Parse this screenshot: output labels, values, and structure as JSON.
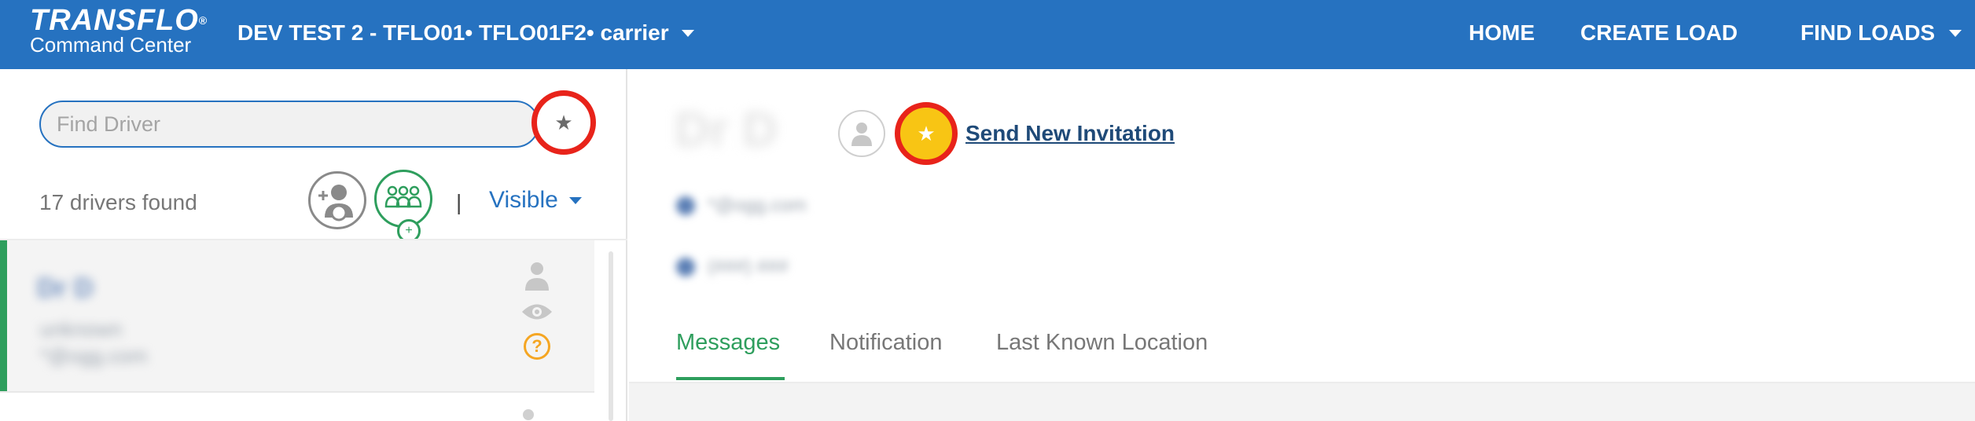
{
  "app": {
    "brand_name": "TRANSFLO",
    "brand_mark": "®",
    "brand_subtitle": "Command Center"
  },
  "header": {
    "account_label": "DEV TEST 2 - TFLO01• TFLO01F2• carrier",
    "nav": {
      "home": "HOME",
      "create_load": "CREATE LOAD",
      "find_loads": "FIND LOADS"
    }
  },
  "sidebar": {
    "search_placeholder": "Find Driver",
    "search_value": "",
    "drivers_found": "17 drivers found",
    "separator": "|",
    "visibility_filter": "Visible",
    "drivers": [
      {
        "name": "Dr D",
        "line1": "unknown",
        "line2": "*@ogg.com",
        "status_icon": "question-icon",
        "status_symbol": "?"
      }
    ]
  },
  "detail": {
    "driver_name": "Dr D",
    "send_invitation": "Send New Invitation",
    "contacts": [
      "*@ogg.com",
      "(###) ###"
    ],
    "tabs": [
      "Messages",
      "Notification",
      "Last Known Location"
    ],
    "active_tab": "Messages"
  },
  "colors": {
    "header_bg": "#2672c0",
    "accent_green": "#2e9e5d",
    "highlight_red": "#e8231a",
    "star_yellow": "#f8c514",
    "link_blue": "#1f4a78"
  },
  "icons": {
    "favorite_filter": "★",
    "favorite_star": "★",
    "group_badge": "+"
  }
}
